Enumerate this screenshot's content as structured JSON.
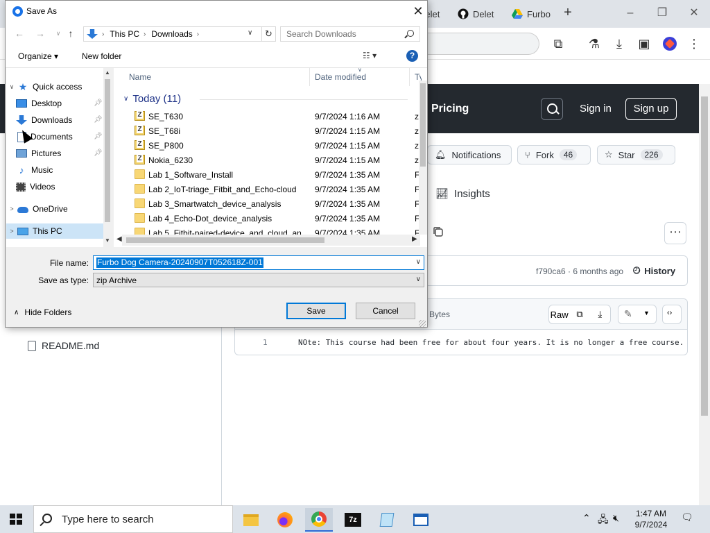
{
  "browser": {
    "tabs": [
      {
        "label": "Delet",
        "icon": "app-icon"
      },
      {
        "label": "Delet",
        "icon": "github-icon"
      },
      {
        "label": "Furbo",
        "icon": "google-drive-icon"
      }
    ],
    "new_tab_label": "+",
    "window_controls": [
      "–",
      "❐",
      "✕"
    ]
  },
  "github": {
    "nav": {
      "pricing": "Pricing",
      "sign_in": "Sign in",
      "sign_up": "Sign up"
    },
    "repo_actions": {
      "notifications": "Notifications",
      "fork_label": "Fork",
      "fork_count": "46",
      "star_label": "Star",
      "star_count": "226"
    },
    "insights": "Insights",
    "commit": {
      "text": "f790ca6 · 6 months ago",
      "history": "History"
    },
    "file": {
      "size": "Bytes",
      "raw": "Raw",
      "line_number": "1",
      "line_text": "NOte: This course had been free for about four years. It is no longer a free course."
    },
    "sidebar": {
      "readme": "README.md"
    }
  },
  "dialog": {
    "title": "Save As",
    "close": "✕",
    "address": {
      "segments": [
        "This PC",
        "Downloads"
      ]
    },
    "search_placeholder": "Search Downloads",
    "toolbar": {
      "organize": "Organize ▾",
      "new_folder": "New folder",
      "help": "?"
    },
    "nav_pane": [
      {
        "label": "Quick access",
        "icon": "star-icon",
        "expand": "∨",
        "indent": 0,
        "pinned": false
      },
      {
        "label": "Desktop",
        "icon": "desktop-icon",
        "expand": "",
        "indent": 1,
        "pinned": true
      },
      {
        "label": "Downloads",
        "icon": "downloads-icon",
        "expand": "",
        "indent": 1,
        "pinned": true
      },
      {
        "label": "Documents",
        "icon": "documents-icon",
        "expand": "",
        "indent": 1,
        "pinned": true
      },
      {
        "label": "Pictures",
        "icon": "pictures-icon",
        "expand": "",
        "indent": 1,
        "pinned": true
      },
      {
        "label": "Music",
        "icon": "music-icon",
        "expand": "",
        "indent": 1,
        "pinned": false
      },
      {
        "label": "Videos",
        "icon": "videos-icon",
        "expand": "",
        "indent": 1,
        "pinned": false
      },
      {
        "label": "OneDrive",
        "icon": "onedrive-icon",
        "expand": ">",
        "indent": 0,
        "pinned": false
      },
      {
        "label": "This PC",
        "icon": "this-pc-icon",
        "expand": ">",
        "indent": 0,
        "pinned": false,
        "selected": true
      }
    ],
    "columns": {
      "name": "Name",
      "date_modified": "Date modified",
      "type": "Ty"
    },
    "group_header": "Today (11)",
    "files": [
      {
        "name": "SE_T630",
        "date": "9/7/2024 1:16 AM",
        "type": "zi",
        "kind": "zip"
      },
      {
        "name": "SE_T68i",
        "date": "9/7/2024 1:15 AM",
        "type": "zi",
        "kind": "zip"
      },
      {
        "name": "SE_P800",
        "date": "9/7/2024 1:15 AM",
        "type": "zi",
        "kind": "zip"
      },
      {
        "name": "Nokia_6230",
        "date": "9/7/2024 1:15 AM",
        "type": "zi",
        "kind": "zip"
      },
      {
        "name": "Lab 1_Software_Install",
        "date": "9/7/2024 1:35 AM",
        "type": "Fi",
        "kind": "folder"
      },
      {
        "name": "Lab 2_IoT-triage_Fitbit_and_Echo-cloud",
        "date": "9/7/2024 1:35 AM",
        "type": "Fi",
        "kind": "folder"
      },
      {
        "name": "Lab 3_Smartwatch_device_analysis",
        "date": "9/7/2024 1:35 AM",
        "type": "Fi",
        "kind": "folder"
      },
      {
        "name": "Lab 4_Echo-Dot_device_analysis",
        "date": "9/7/2024 1:35 AM",
        "type": "Fi",
        "kind": "folder"
      },
      {
        "name": "Lab 5_Fitbit-paired-device_and_cloud_an...",
        "date": "9/7/2024 1:35 AM",
        "type": "Fi",
        "kind": "folder"
      }
    ],
    "file_name_label": "File name:",
    "file_name_value": "Furbo Dog Camera-20240907T052618Z-001",
    "save_type_label": "Save as type:",
    "save_type_value": "zip Archive",
    "hide_folders": "Hide Folders",
    "save": "Save",
    "cancel": "Cancel"
  },
  "taskbar": {
    "search_placeholder": "Type here to search",
    "apps": [
      "file-explorer-icon",
      "firefox-icon",
      "chrome-icon",
      "7zip-icon",
      "notepad-icon",
      "app-window-icon"
    ],
    "time": "1:47 AM",
    "date": "9/7/2024"
  },
  "colors": {
    "accent": "#0078d7",
    "github_header": "#24292f",
    "taskbar": "#dde3ea"
  }
}
